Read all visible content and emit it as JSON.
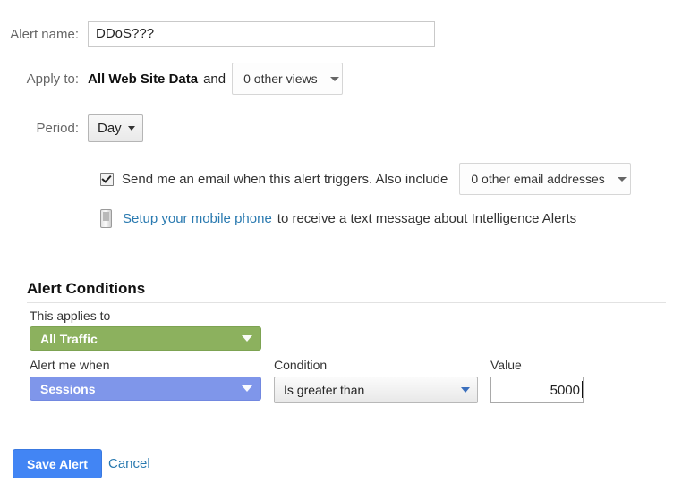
{
  "form": {
    "alert_name": {
      "label": "Alert name:",
      "value": "DDoS???",
      "placeholder": ""
    },
    "apply_to": {
      "label": "Apply to:",
      "primary_view": "All Web Site Data",
      "conjunction": "and",
      "other_views_select": "0 other views"
    },
    "period": {
      "label": "Period:",
      "value": "Day"
    },
    "email_notification": {
      "checked": true,
      "text": "Send me an email when this alert triggers. Also include",
      "addresses_select": "0 other email addresses"
    },
    "mobile_phone": {
      "icon": "mobile-phone-icon",
      "link_text": "Setup your mobile phone",
      "rest_text": "to receive a text message about Intelligence Alerts"
    }
  },
  "alert_conditions": {
    "heading": "Alert Conditions",
    "applies_to": {
      "label": "This applies to",
      "value": "All Traffic",
      "color": "#8cb15e"
    },
    "metric": {
      "label": "Alert me when",
      "value": "Sessions",
      "color": "#7f96ea"
    },
    "condition": {
      "label": "Condition",
      "value": "Is greater than"
    },
    "value": {
      "label": "Value",
      "value": "5000",
      "placeholder": ""
    }
  },
  "actions": {
    "save_label": "Save Alert",
    "cancel_label": "Cancel",
    "save_color": "#4285f4",
    "link_color": "#2a7ab0"
  }
}
